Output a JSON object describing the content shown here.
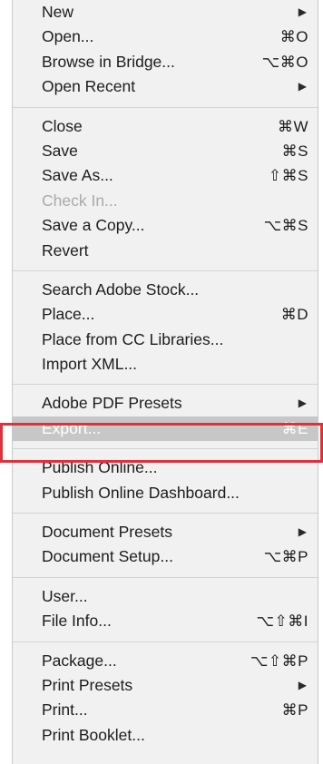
{
  "menu": {
    "sections": [
      [
        {
          "label": "New",
          "shortcut": "",
          "submenu": true
        },
        {
          "label": "Open...",
          "shortcut": "⌘O",
          "submenu": false
        },
        {
          "label": "Browse in Bridge...",
          "shortcut": "⌥⌘O",
          "submenu": false
        },
        {
          "label": "Open Recent",
          "shortcut": "",
          "submenu": true
        }
      ],
      [
        {
          "label": "Close",
          "shortcut": "⌘W",
          "submenu": false
        },
        {
          "label": "Save",
          "shortcut": "⌘S",
          "submenu": false
        },
        {
          "label": "Save As...",
          "shortcut": "⇧⌘S",
          "submenu": false
        },
        {
          "label": "Check In...",
          "shortcut": "",
          "submenu": false,
          "disabled": true
        },
        {
          "label": "Save a Copy...",
          "shortcut": "⌥⌘S",
          "submenu": false
        },
        {
          "label": "Revert",
          "shortcut": "",
          "submenu": false
        }
      ],
      [
        {
          "label": "Search Adobe Stock...",
          "shortcut": "",
          "submenu": false
        },
        {
          "label": "Place...",
          "shortcut": "⌘D",
          "submenu": false
        },
        {
          "label": "Place from CC Libraries...",
          "shortcut": "",
          "submenu": false
        },
        {
          "label": "Import XML...",
          "shortcut": "",
          "submenu": false
        }
      ],
      [
        {
          "label": "Adobe PDF Presets",
          "shortcut": "",
          "submenu": true
        },
        {
          "label": "Export...",
          "shortcut": "⌘E",
          "submenu": false,
          "highlighted": true
        }
      ],
      [
        {
          "label": "Publish Online...",
          "shortcut": "",
          "submenu": false
        },
        {
          "label": "Publish Online Dashboard...",
          "shortcut": "",
          "submenu": false
        }
      ],
      [
        {
          "label": "Document Presets",
          "shortcut": "",
          "submenu": true
        },
        {
          "label": "Document Setup...",
          "shortcut": "⌥⌘P",
          "submenu": false
        }
      ],
      [
        {
          "label": "User...",
          "shortcut": "",
          "submenu": false
        },
        {
          "label": "File Info...",
          "shortcut": "⌥⇧⌘I",
          "submenu": false
        }
      ],
      [
        {
          "label": "Package...",
          "shortcut": "⌥⇧⌘P",
          "submenu": false
        },
        {
          "label": "Print Presets",
          "shortcut": "",
          "submenu": true
        },
        {
          "label": "Print...",
          "shortcut": "⌘P",
          "submenu": false
        },
        {
          "label": "Print Booklet...",
          "shortcut": "",
          "submenu": false
        }
      ]
    ],
    "submenu_arrow": "▶",
    "highlight_outline_color": "#e0303a"
  }
}
